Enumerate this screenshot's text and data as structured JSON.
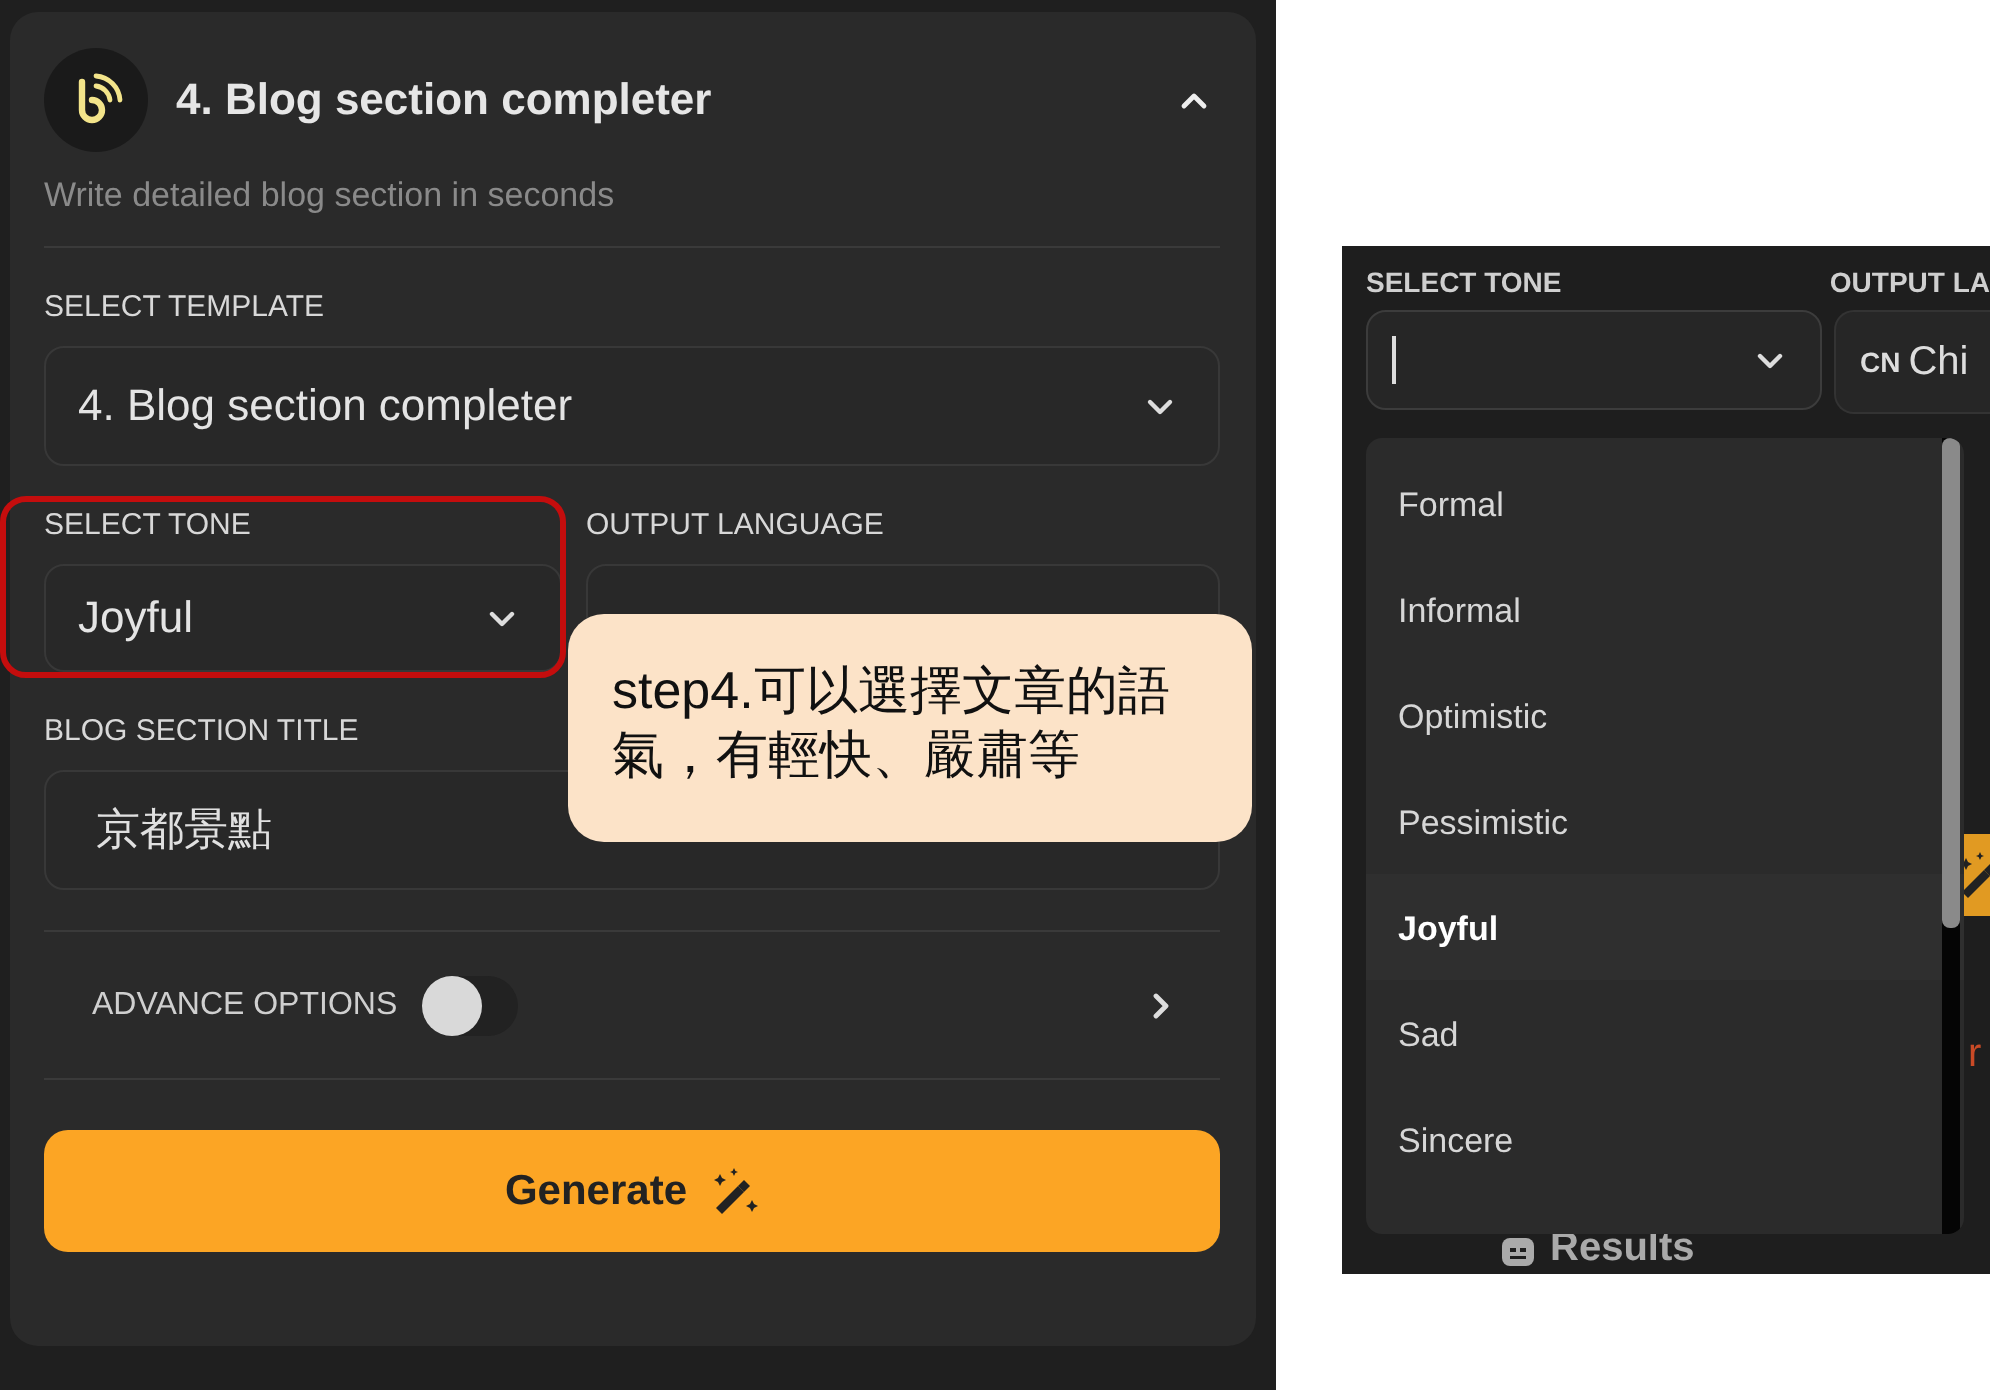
{
  "panel": {
    "title": "4. Blog section completer",
    "expanded": true,
    "subtitle": "Write detailed blog section in seconds"
  },
  "template": {
    "label": "SELECT TEMPLATE",
    "value": "4. Blog section completer"
  },
  "tone": {
    "label": "SELECT TONE",
    "value": "Joyful",
    "highlighted": true
  },
  "language": {
    "label": "OUTPUT LANGUAGE"
  },
  "blog_title": {
    "label": "BLOG SECTION TITLE",
    "value": "京都景點"
  },
  "advance_options": {
    "label": "ADVANCE OPTIONS",
    "on": false
  },
  "generate_button": {
    "label": "Generate"
  },
  "callout": {
    "text": "step4.可以選擇文章的語氣，有輕快、嚴肅等"
  },
  "zoomed": {
    "tone_label": "SELECT TONE",
    "language_label": "OUTPUT LA",
    "language_code": "CN",
    "language_value": "Chi",
    "behind_text": "r",
    "results_label": "Results",
    "options": [
      {
        "label": "Formal",
        "selected": false
      },
      {
        "label": "Informal",
        "selected": false
      },
      {
        "label": "Optimistic",
        "selected": false
      },
      {
        "label": "Pessimistic",
        "selected": false
      },
      {
        "label": "Joyful",
        "selected": true
      },
      {
        "label": "Sad",
        "selected": false
      },
      {
        "label": "Sincere",
        "selected": false
      }
    ]
  }
}
